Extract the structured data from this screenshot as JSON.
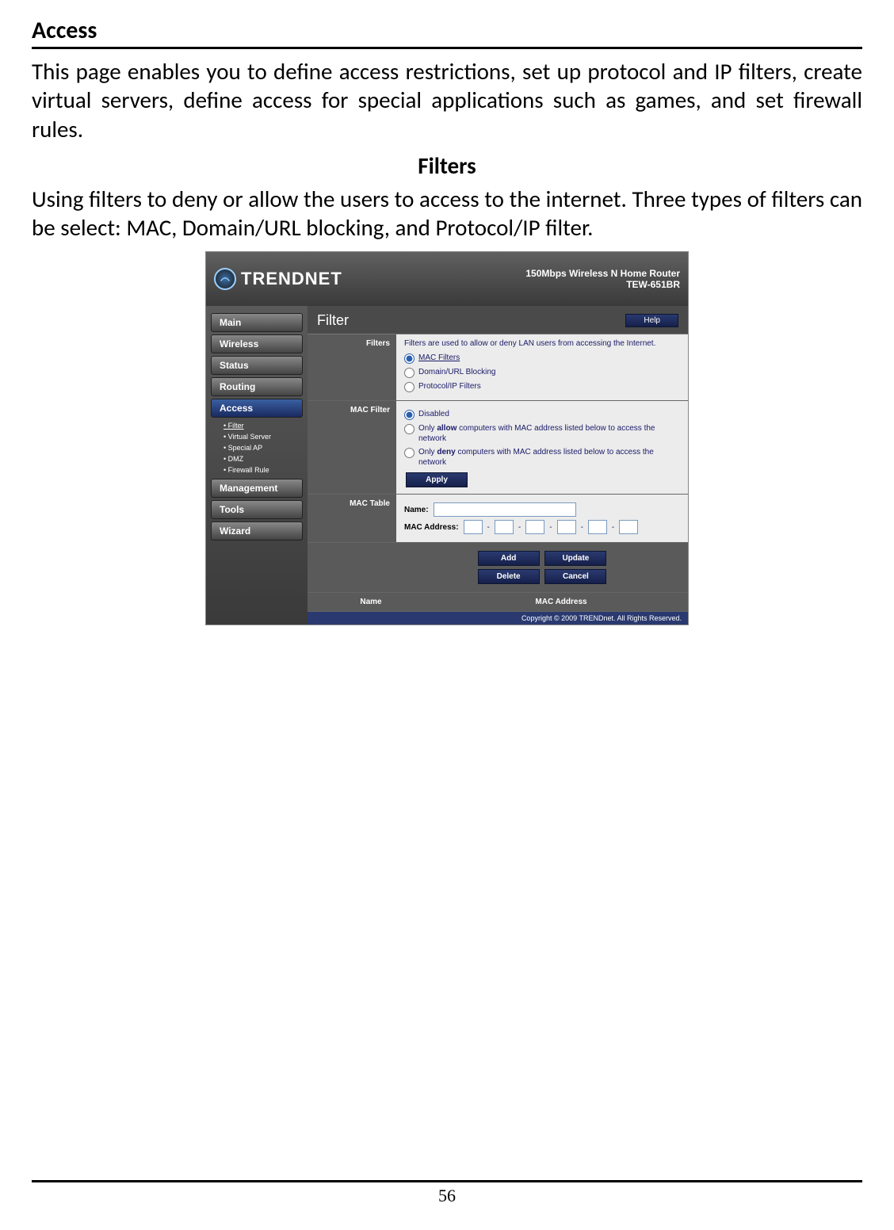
{
  "doc": {
    "section_title": "Access",
    "intro": "This page enables you to define access restrictions, set up protocol and IP filters, create virtual servers, define access for special applications such as games, and set firewall rules.",
    "sub_title": "Filters",
    "sub_intro": "Using filters to deny or allow the users to access to the internet.  Three types of filters can be select: MAC, Domain/URL blocking, and Protocol/IP filter.",
    "page_number": "56"
  },
  "ui": {
    "brand": "TRENDNET",
    "model_line1": "150Mbps Wireless N Home Router",
    "model_line2": "TEW-651BR",
    "nav": {
      "main": "Main",
      "wireless": "Wireless",
      "status": "Status",
      "routing": "Routing",
      "access": "Access",
      "management": "Management",
      "tools": "Tools",
      "wizard": "Wizard"
    },
    "subnav": {
      "filter": "Filter",
      "virtual_server": "Virtual Server",
      "special_ap": "Special AP",
      "dmz": "DMZ",
      "firewall_rule": "Firewall Rule"
    },
    "page_title": "Filter",
    "help_label": "Help",
    "rows": {
      "filters_label": "Filters",
      "filters_desc": "Filters are used to allow or deny LAN users from accessing the Internet.",
      "opt_mac": "MAC Filters",
      "opt_domain": "Domain/URL Blocking",
      "opt_protocol": "Protocol/IP Filters",
      "macfilter_label": "MAC Filter",
      "mf_disabled": "Disabled",
      "mf_allow": "Only allow computers with MAC address listed below to access the network",
      "mf_deny": "Only deny computers with MAC address listed below to access the network",
      "apply": "Apply",
      "mactable_label": "MAC Table",
      "name_label": "Name:",
      "mac_label": "MAC Address:",
      "add": "Add",
      "update": "Update",
      "delete": "Delete",
      "cancel": "Cancel",
      "th_name": "Name",
      "th_mac": "MAC Address"
    },
    "footer": "Copyright © 2009 TRENDnet. All Rights Reserved."
  }
}
